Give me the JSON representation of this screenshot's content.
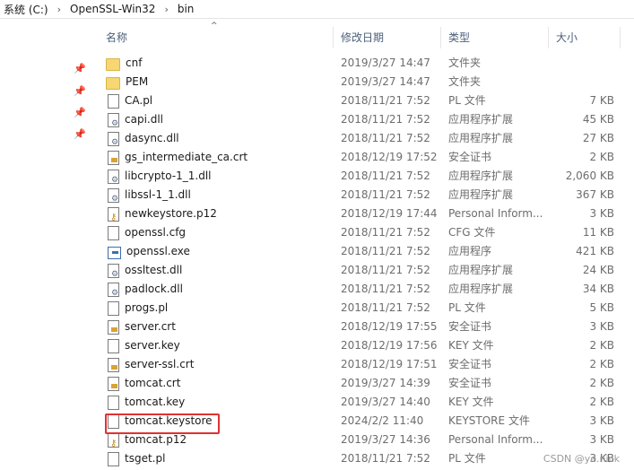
{
  "breadcrumb": [
    "系统 (C:)",
    "OpenSSL-Win32",
    "bin"
  ],
  "columns": {
    "name": "名称",
    "date": "修改日期",
    "type": "类型",
    "size": "大小"
  },
  "files": [
    {
      "name": "cnf",
      "date": "2019/3/27 14:47",
      "type": "文件夹",
      "size": "",
      "icon": "folder-icon"
    },
    {
      "name": "PEM",
      "date": "2019/3/27 14:47",
      "type": "文件夹",
      "size": "",
      "icon": "folder-icon"
    },
    {
      "name": "CA.pl",
      "date": "2018/11/21 7:52",
      "type": "PL 文件",
      "size": "7 KB",
      "icon": "file-icon"
    },
    {
      "name": "capi.dll",
      "date": "2018/11/21 7:52",
      "type": "应用程序扩展",
      "size": "45 KB",
      "icon": "dll-icon"
    },
    {
      "name": "dasync.dll",
      "date": "2018/11/21 7:52",
      "type": "应用程序扩展",
      "size": "27 KB",
      "icon": "dll-icon"
    },
    {
      "name": "gs_intermediate_ca.crt",
      "date": "2018/12/19 17:52",
      "type": "安全证书",
      "size": "2 KB",
      "icon": "certificate-icon"
    },
    {
      "name": "libcrypto-1_1.dll",
      "date": "2018/11/21 7:52",
      "type": "应用程序扩展",
      "size": "2,060 KB",
      "icon": "dll-icon"
    },
    {
      "name": "libssl-1_1.dll",
      "date": "2018/11/21 7:52",
      "type": "应用程序扩展",
      "size": "367 KB",
      "icon": "dll-icon"
    },
    {
      "name": "newkeystore.p12",
      "date": "2018/12/19 17:44",
      "type": "Personal Inform...",
      "size": "3 KB",
      "icon": "p12-icon"
    },
    {
      "name": "openssl.cfg",
      "date": "2018/11/21 7:52",
      "type": "CFG 文件",
      "size": "11 KB",
      "icon": "file-icon"
    },
    {
      "name": "openssl.exe",
      "date": "2018/11/21 7:52",
      "type": "应用程序",
      "size": "421 KB",
      "icon": "exe-icon"
    },
    {
      "name": "ossltest.dll",
      "date": "2018/11/21 7:52",
      "type": "应用程序扩展",
      "size": "24 KB",
      "icon": "dll-icon"
    },
    {
      "name": "padlock.dll",
      "date": "2018/11/21 7:52",
      "type": "应用程序扩展",
      "size": "34 KB",
      "icon": "dll-icon"
    },
    {
      "name": "progs.pl",
      "date": "2018/11/21 7:52",
      "type": "PL 文件",
      "size": "5 KB",
      "icon": "file-icon"
    },
    {
      "name": "server.crt",
      "date": "2018/12/19 17:55",
      "type": "安全证书",
      "size": "3 KB",
      "icon": "certificate-icon"
    },
    {
      "name": "server.key",
      "date": "2018/12/19 17:56",
      "type": "KEY 文件",
      "size": "2 KB",
      "icon": "file-icon"
    },
    {
      "name": "server-ssl.crt",
      "date": "2018/12/19 17:51",
      "type": "安全证书",
      "size": "2 KB",
      "icon": "certificate-icon"
    },
    {
      "name": "tomcat.crt",
      "date": "2019/3/27 14:39",
      "type": "安全证书",
      "size": "2 KB",
      "icon": "certificate-icon"
    },
    {
      "name": "tomcat.key",
      "date": "2019/3/27 14:40",
      "type": "KEY 文件",
      "size": "2 KB",
      "icon": "file-icon"
    },
    {
      "name": "tomcat.keystore",
      "date": "2024/2/2 11:40",
      "type": "KEYSTORE 文件",
      "size": "3 KB",
      "icon": "file-icon"
    },
    {
      "name": "tomcat.p12",
      "date": "2019/3/27 14:36",
      "type": "Personal Inform...",
      "size": "3 KB",
      "icon": "p12-icon"
    },
    {
      "name": "tsget.pl",
      "date": "2018/11/21 7:52",
      "type": "PL 文件",
      "size": "3 KB",
      "icon": "file-icon"
    }
  ],
  "watermark": "CSDN @ye.nick",
  "colors": {
    "highlight": "#e03131",
    "folder": "#f7d774",
    "header_text": "#4c607a"
  }
}
